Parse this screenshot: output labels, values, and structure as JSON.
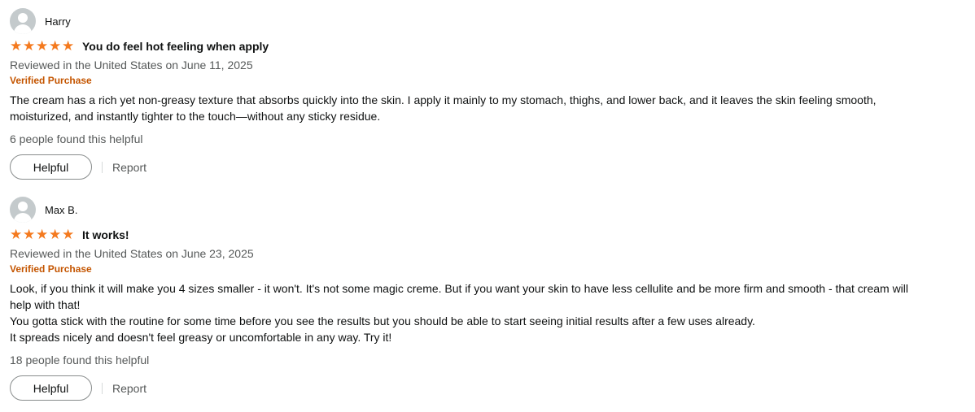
{
  "colors": {
    "star": "#f47a1f",
    "verified": "#c45500",
    "secondary_text": "#565959"
  },
  "reviews": [
    {
      "reviewer": "Harry",
      "avatar_icon": "user-avatar-icon",
      "rating": 5,
      "title": "You do feel hot feeling when apply",
      "date": "Reviewed in the United States on June 11, 2025",
      "badge": "Verified Purchase",
      "body": [
        "The cream has a rich yet non-greasy texture that absorbs quickly into the skin. I apply it mainly to my stomach, thighs, and lower back, and it leaves the skin feeling smooth, moisturized, and instantly tighter to the touch—without any sticky residue."
      ],
      "helpful_count": "6 people found this helpful",
      "helpful_label": "Helpful",
      "report_label": "Report"
    },
    {
      "reviewer": "Max B.",
      "avatar_icon": "user-avatar-icon",
      "rating": 5,
      "title": "It works!",
      "date": "Reviewed in the United States on June 23, 2025",
      "badge": "Verified Purchase",
      "body": [
        "Look, if you think it will make you 4 sizes smaller - it won't. It's not some magic creme. But if you want your skin to have less cellulite and be more firm and smooth - that cream will help with that!",
        "You gotta stick with the routine for some time before you see the results but you should be able to start seeing initial results after a few uses already.",
        "It spreads nicely and doesn't feel greasy or uncomfortable in any way. Try it!"
      ],
      "helpful_count": "18 people found this helpful",
      "helpful_label": "Helpful",
      "report_label": "Report"
    }
  ]
}
